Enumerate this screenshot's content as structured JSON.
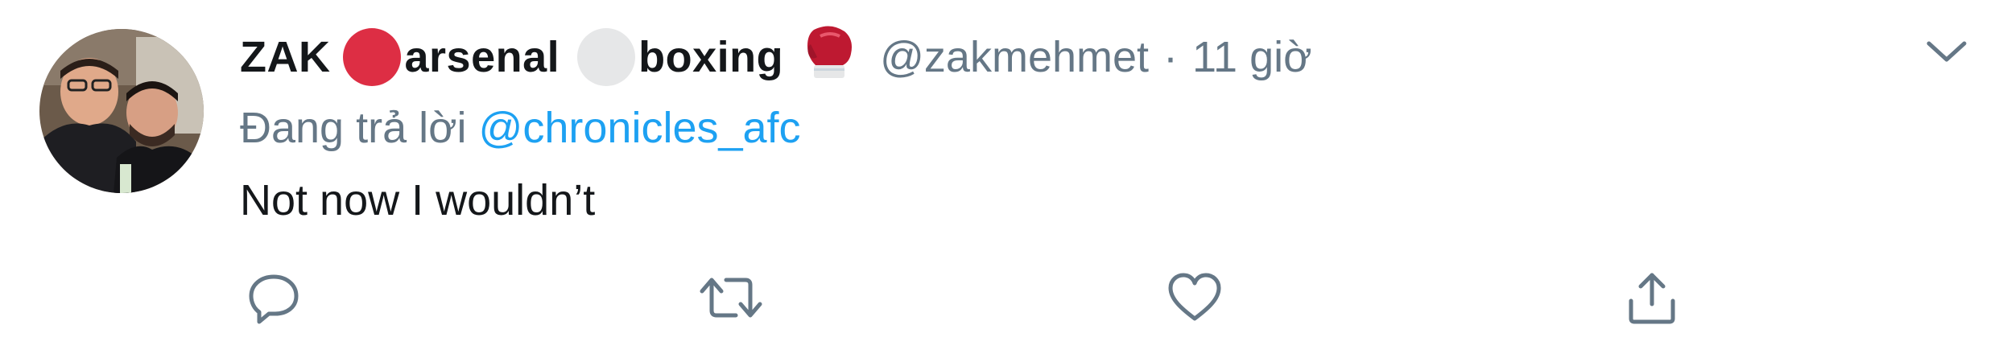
{
  "tweet": {
    "author": {
      "name_part1": "ZAK",
      "name_part2": "arsenal",
      "name_part3": "boxing",
      "emoji_1": "red-circle-emoji",
      "emoji_2": "white-circle-emoji",
      "emoji_3": "boxing-glove-emoji",
      "handle": "@zakmehmet"
    },
    "separator": "·",
    "timestamp": "11 giờ",
    "reply_prefix": "Đang trả lời",
    "reply_to": "@chronicles_afc",
    "text": "Not now I wouldn’t"
  },
  "actions": {
    "reply_icon": "reply-icon",
    "retweet_icon": "retweet-icon",
    "like_icon": "heart-icon",
    "share_icon": "share-icon",
    "menu_icon": "chevron-down-icon"
  },
  "colors": {
    "primary_text": "#14171a",
    "secondary_text": "#657786",
    "link": "#1da1f2",
    "red_circle": "#dd2e44",
    "white_circle": "#e6e7e8",
    "glove": "#be1931"
  }
}
